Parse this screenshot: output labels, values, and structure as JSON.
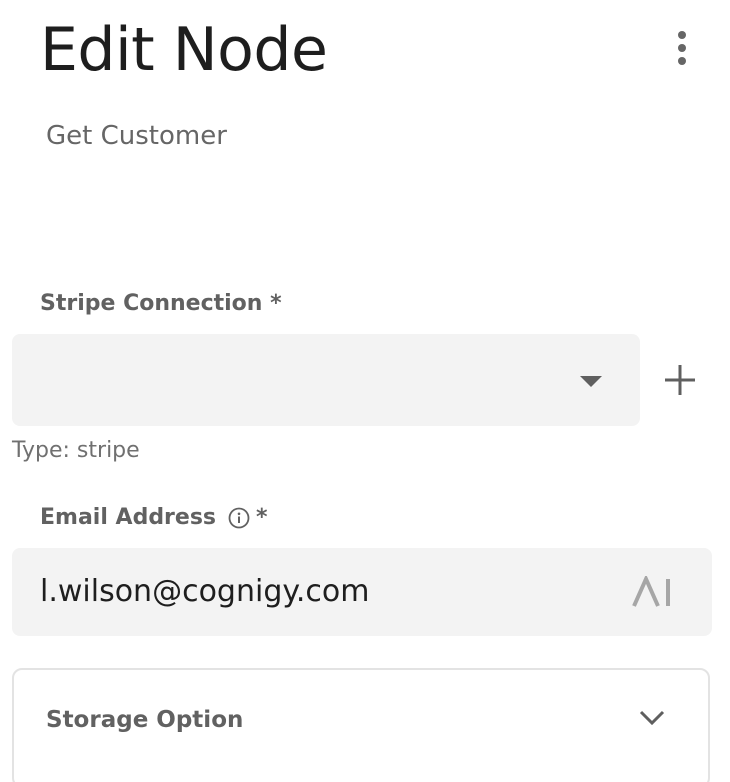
{
  "header": {
    "title": "Edit Node",
    "more_menu_icon": "more-vertical-icon"
  },
  "node": {
    "subtitle": "Get Customer"
  },
  "fields": {
    "connection": {
      "label": "Stripe Connection *",
      "value": "",
      "helper": "Type: stripe",
      "add_icon": "plus-icon",
      "dropdown_icon": "caret-down-icon"
    },
    "email": {
      "label": "Email Address",
      "required_marker": "*",
      "value": "l.wilson@cognigy.com",
      "info_icon": "info-icon",
      "ai_icon": "ai-icon"
    }
  },
  "sections": {
    "storage": {
      "label": "Storage Option",
      "expand_icon": "chevron-down-icon"
    }
  },
  "colors": {
    "field_bg": "#f3f3f3",
    "title_text": "#1e1e1e",
    "muted_text": "#616161",
    "border": "#e3e3e3"
  }
}
